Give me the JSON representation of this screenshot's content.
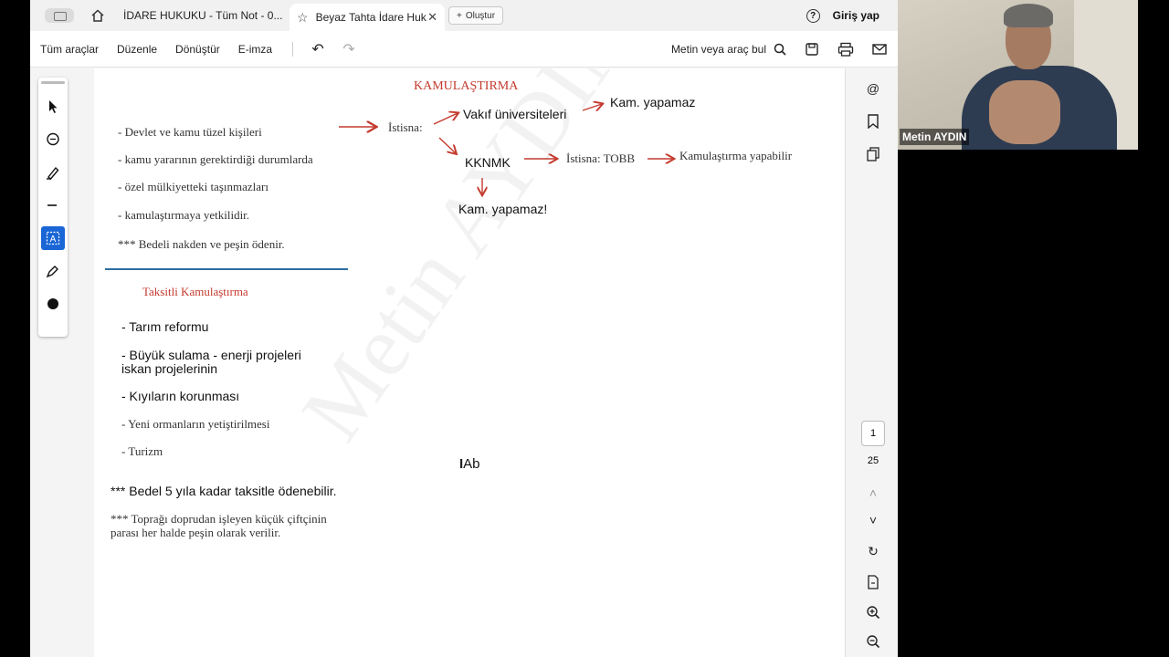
{
  "tabs": {
    "inactive_label": "İDARE HUKUKU - Tüm Not - 0...",
    "active_label": "Beyaz Tahta İdare Huk...",
    "new_tab": "Oluştur",
    "signin": "Giriş yap"
  },
  "toolbar": {
    "all_tools": "Tüm araçlar",
    "edit": "Düzenle",
    "convert": "Dönüştür",
    "esign": "E-imza",
    "find": "Metin veya araç bul"
  },
  "pager": {
    "current": "1",
    "total": "25"
  },
  "doc": {
    "title": "KAMULAŞTIRMA",
    "left_items": [
      "- Devlet ve kamu tüzel kişileri",
      "- kamu yararının gerektirdiği durumlarda",
      "- özel mülkiyetteki taşınmazları",
      "- kamulaştırmaya yetkilidir."
    ],
    "note1": "*** Bedeli nakden ve peşin ödenir.",
    "istisna": "İstisna:",
    "vakif": "Vakıf üniversiteleri",
    "kam_yapamaz_1": "Kam. yapamaz",
    "kknmk": "KKNMK",
    "istisna_tobb": "İstisna: TOBB",
    "kam_yapabilir": "Kamulaştırma yapabilir",
    "kam_yapamaz_2": "Kam. yapamaz!",
    "taksitli_title": "Taksitli Kamulaştırma",
    "taksitli_items": [
      "- Tarım reformu",
      "- Büyük sulama - enerji projeleri",
      "iskan projelerinin",
      "- Kıyıların korunması",
      "- Yeni ormanların yetiştirilmesi",
      "- Turizm"
    ],
    "note2": "*** Bedel 5 yıla kadar taksitle ödenebilir.",
    "note3_line1": "*** Toprağı doprudan işleyen küçük çiftçinin",
    "note3_line2": "parası her halde peşin olarak verilir.",
    "cursor_text": "Ab",
    "watermark": "Metin AYDIN"
  },
  "video": {
    "name": "Metin AYDIN"
  },
  "colors": {
    "accent_red": "#c43a2e",
    "tool_active": "#1a66d6",
    "divider": "#2c6ea0"
  }
}
